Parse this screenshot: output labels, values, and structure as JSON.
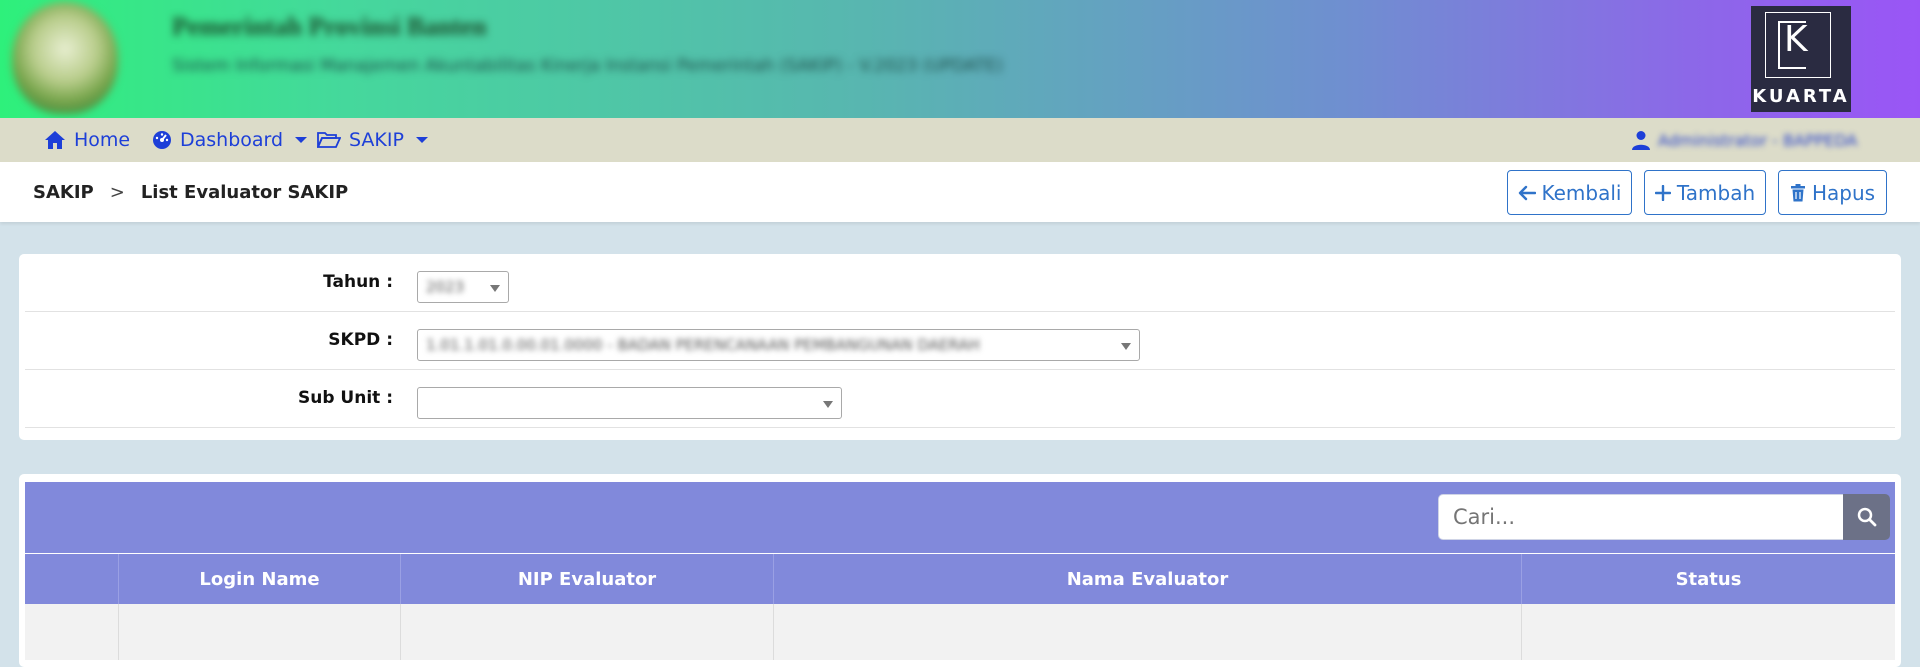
{
  "banner": {
    "title": "Pemerintah Provinsi Banten",
    "subtitle": "Sistem Informasi Manajemen Akuntabilitas Kinerja Instansi Pemerintah (SAKIP) - V.2023 (UPDATE)",
    "brand_name": "KUARTA",
    "brand_letter": "K"
  },
  "nav": {
    "home": "Home",
    "dashboard": "Dashboard",
    "sakip": "SAKIP",
    "user": "Administrator - BAPPEDA"
  },
  "breadcrumb": {
    "root": "SAKIP",
    "separator": ">",
    "current": "List Evaluator SAKIP"
  },
  "actions": {
    "back": "Kembali",
    "add": "Tambah",
    "delete": "Hapus"
  },
  "filters": {
    "tahun_label": "Tahun :",
    "tahun_value": "2023",
    "skpd_label": "SKPD :",
    "skpd_value": "1.01.1.01.0.00.01.0000 - BADAN PERENCANAAN PEMBANGUNAN DAERAH",
    "subunit_label": "Sub Unit :",
    "subunit_value": ""
  },
  "table": {
    "search_placeholder": "Cari...",
    "columns": [
      "",
      "Login Name",
      "NIP Evaluator",
      "Nama Evaluator",
      "Status"
    ]
  },
  "colors": {
    "table_header": "#8189db",
    "link": "#1d3fd8",
    "button": "#2f73c9"
  }
}
